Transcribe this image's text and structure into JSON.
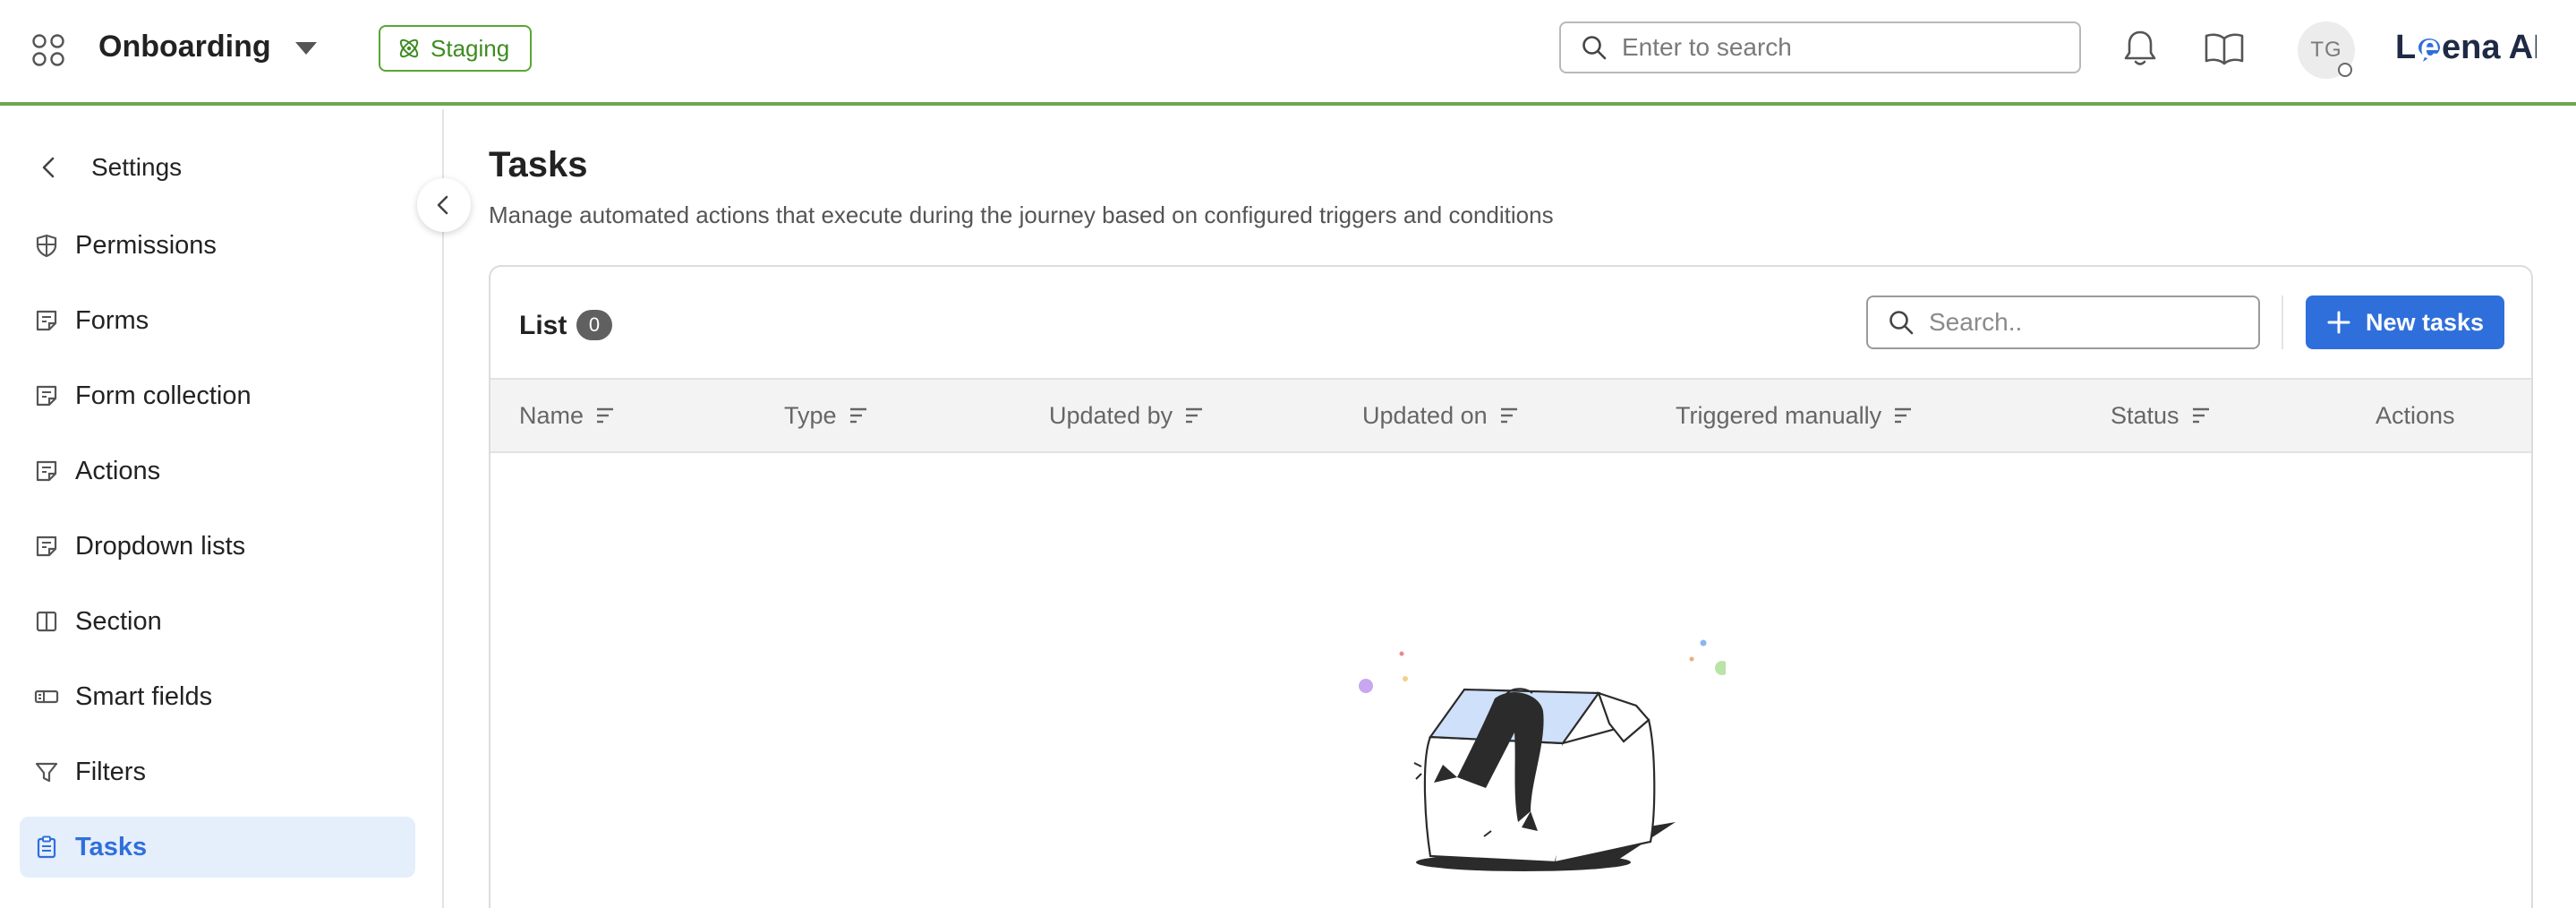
{
  "header": {
    "app_title": "Onboarding",
    "environment_badge": "Staging",
    "search_placeholder": "Enter to search",
    "avatar_initials": "TG",
    "brand_text": "Leena AI"
  },
  "sidebar": {
    "title": "Settings",
    "items": [
      {
        "label": "Permissions",
        "icon": "shield-icon"
      },
      {
        "label": "Forms",
        "icon": "form-icon"
      },
      {
        "label": "Form collection",
        "icon": "form-icon"
      },
      {
        "label": "Actions",
        "icon": "form-icon"
      },
      {
        "label": "Dropdown lists",
        "icon": "form-icon"
      },
      {
        "label": "Section",
        "icon": "columns-icon"
      },
      {
        "label": "Smart fields",
        "icon": "smart-field-icon"
      },
      {
        "label": "Filters",
        "icon": "filter-icon"
      },
      {
        "label": "Tasks",
        "icon": "clipboard-icon",
        "active": true
      }
    ]
  },
  "main": {
    "title": "Tasks",
    "subtitle": "Manage automated actions that execute during the journey based on configured triggers and conditions",
    "list": {
      "title": "List",
      "count": "0",
      "search_placeholder": "Search..",
      "new_button_label": "New tasks",
      "columns": [
        "Name",
        "Type",
        "Updated by",
        "Updated on",
        "Triggered manually",
        "Status",
        "Actions"
      ]
    }
  },
  "colors": {
    "accent": "#2f6fdb",
    "staging_green": "#3d8c20",
    "header_rule": "#6aa84f",
    "active_item_bg": "#e5eefb"
  }
}
